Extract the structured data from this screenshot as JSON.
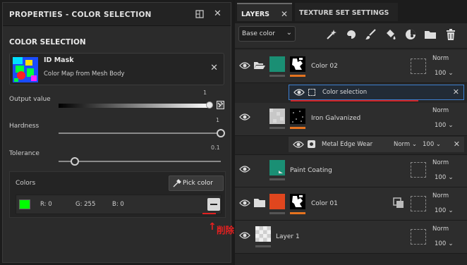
{
  "left_panel": {
    "title": "PROPERTIES - COLOR SELECTION",
    "section_title": "COLOR SELECTION",
    "id_mask": {
      "name": "ID Mask",
      "description": "Color Map from Mesh Body"
    },
    "output_value": {
      "label": "Output value",
      "value": "1"
    },
    "hardness": {
      "label": "Hardness",
      "value": "1",
      "level": 1.0
    },
    "tolerance": {
      "label": "Tolerance",
      "value": "0.1",
      "level": 0.1
    },
    "colors": {
      "label": "Colors",
      "pick_button": "Pick color",
      "swatch_color": "#00ff00",
      "r": "R: 0",
      "g": "G: 255",
      "b": "B: 0"
    },
    "annotation": {
      "arrow": "↑",
      "text": "削除"
    }
  },
  "right_panel": {
    "tabs": [
      {
        "label": "LAYERS"
      },
      {
        "label": "TEXTURE SET SETTINGS"
      }
    ],
    "channel_select": "Base color",
    "toolbar_icons": [
      "magic-wand-icon",
      "fill-icon",
      "brush-icon",
      "smart-material-icon",
      "folder-icon",
      "trash-icon"
    ],
    "layers": [
      {
        "name": "Color 02",
        "blend": "Norm",
        "opacity": "100"
      },
      {
        "name": "Color selection"
      },
      {
        "name": "Iron Galvanized",
        "blend": "Norm",
        "opacity": "100"
      },
      {
        "name": "Metal Edge Wear",
        "blend": "Norm",
        "opacity": "100"
      },
      {
        "name": "Paint Coating",
        "blend": "Norm",
        "opacity": "100"
      },
      {
        "name": "Color 01",
        "blend": "Norm",
        "opacity": "100"
      },
      {
        "name": "Layer 1",
        "blend": "Norm",
        "opacity": "100"
      }
    ],
    "colors": {
      "teal": "#1a8f74",
      "orange": "#e5731f",
      "orange_red": "#e0461e",
      "selection_blue": "#3d7fd0"
    }
  }
}
